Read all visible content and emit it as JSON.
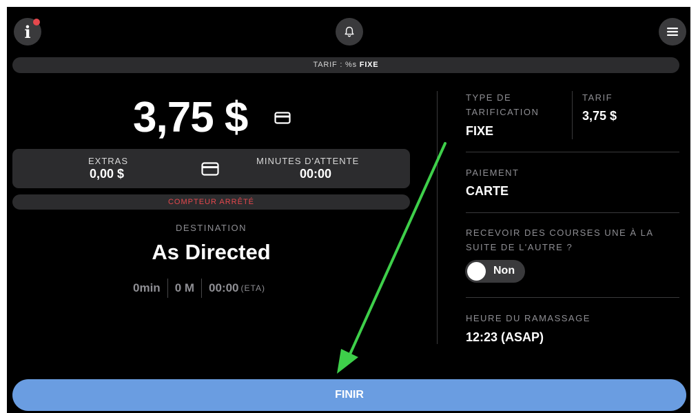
{
  "header": {
    "info_icon": "info-icon",
    "bell_icon": "bell-icon",
    "menu_icon": "menu-icon",
    "notification_color": "#e5484d"
  },
  "tarif_bar": {
    "prefix": "TARIF : %s ",
    "value": "FIXE"
  },
  "fare": {
    "amount": "3,75 $",
    "payment_icon": "credit-card-icon"
  },
  "extras": {
    "label": "EXTRAS",
    "value": "0,00 $"
  },
  "waiting": {
    "label": "MINUTES D'ATTENTE",
    "value": "00:00"
  },
  "meter_status": "COMPTEUR ARRÊTÉ",
  "destination": {
    "label": "DESTINATION",
    "value": "As Directed",
    "duration": "0min",
    "distance": "0 M",
    "eta_time": "00:00",
    "eta_tag": "(ETA)"
  },
  "details": {
    "pricing_type_label_1": "TYPE DE",
    "pricing_type_label_2": "TARIFICATION",
    "pricing_type_value": "FIXE",
    "tarif_label": "TARIF",
    "tarif_value": "3,75 $",
    "payment_label": "PAIEMENT",
    "payment_value": "CARTE",
    "back_to_back_label_1": "RECEVOIR DES COURSES UNE À LA",
    "back_to_back_label_2": "SUITE DE L'AUTRE ?",
    "back_to_back_toggle": "Non",
    "pickup_label": "HEURE DU RAMASSAGE",
    "pickup_value": "12:23 (ASAP)"
  },
  "finish_button": "FINIR",
  "colors": {
    "background": "#000000",
    "panel": "#2c2c2e",
    "accent_button": "#6a9de1",
    "meter_status": "#e5484d",
    "annotation_arrow": "#3ecf4a"
  }
}
